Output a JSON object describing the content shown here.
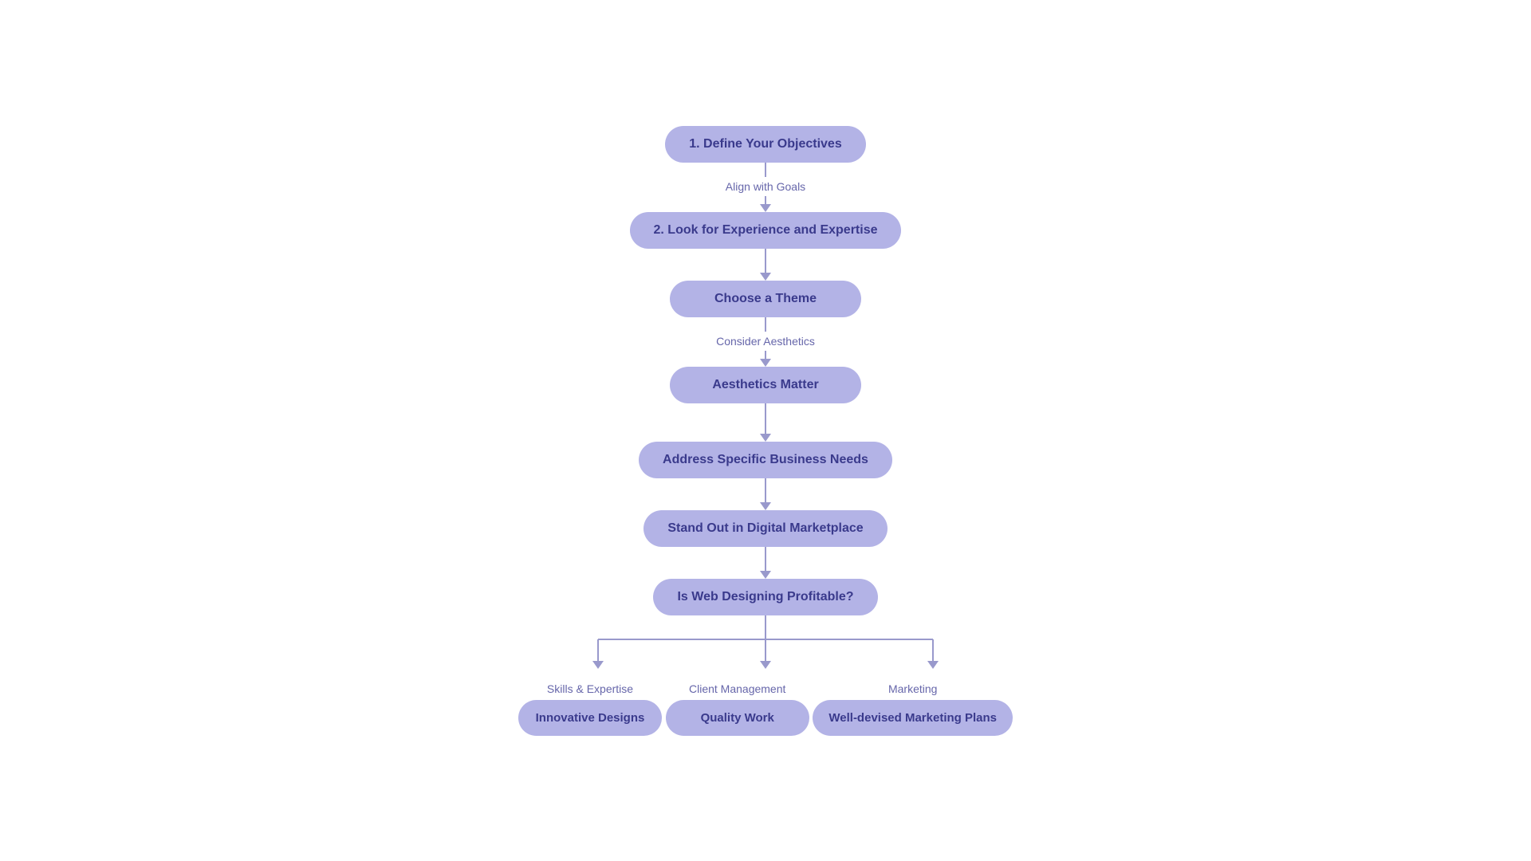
{
  "diagram": {
    "nodes": {
      "define_objectives": "1. Define Your Objectives",
      "look_experience": "2. Look for Experience and Expertise",
      "choose_theme": "Choose a Theme",
      "aesthetics_matter": "Aesthetics Matter",
      "address_business": "Address Specific Business Needs",
      "stand_out": "Stand Out in Digital Marketplace",
      "web_designing": "Is Web Designing Profitable?",
      "innovative_designs": "Innovative Designs",
      "quality_work": "Quality Work",
      "well_devised": "Well-devised Marketing Plans"
    },
    "labels": {
      "align_goals": "Align with Goals",
      "consider_aesthetics": "Consider Aesthetics",
      "skills_expertise": "Skills & Expertise",
      "client_management": "Client Management",
      "marketing": "Marketing"
    },
    "colors": {
      "node_bg": "#b3b3e6",
      "node_text": "#3a3a8c",
      "connector": "#9999cc",
      "label": "#6666aa"
    }
  }
}
